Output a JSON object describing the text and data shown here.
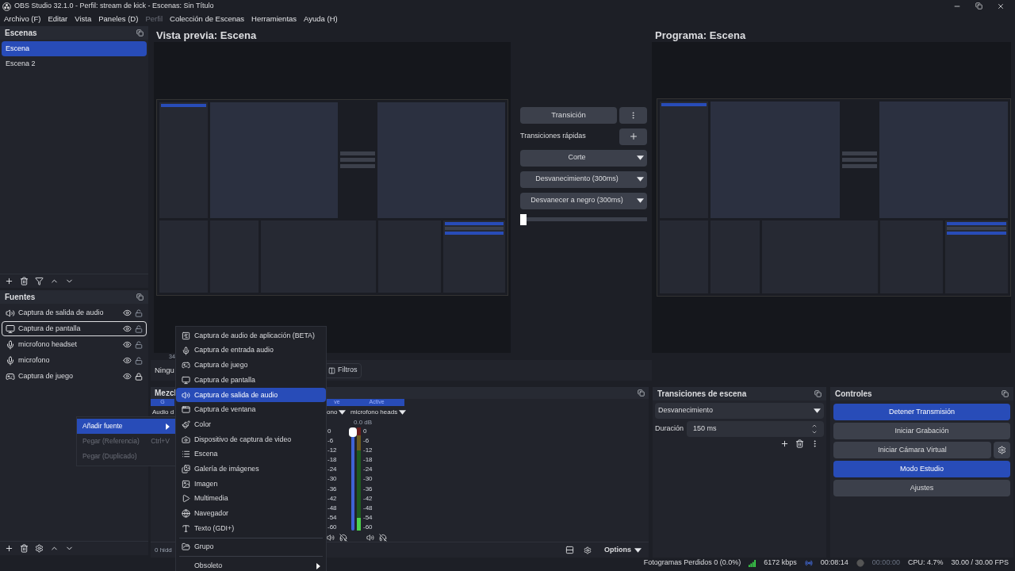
{
  "window": {
    "title": "OBS Studio 32.1.0 - Perfil: stream de kick - Escenas: Sin Título"
  },
  "menubar": [
    {
      "label": "Archivo (F)",
      "disabled": false
    },
    {
      "label": "Editar",
      "disabled": false
    },
    {
      "label": "Vista",
      "disabled": false
    },
    {
      "label": "Paneles (D)",
      "disabled": false
    },
    {
      "label": "Perfil",
      "disabled": true
    },
    {
      "label": "Colección de Escenas",
      "disabled": false
    },
    {
      "label": "Herramientas",
      "disabled": false
    },
    {
      "label": "Ayuda (H)",
      "disabled": false
    }
  ],
  "scenes": {
    "title": "Escenas",
    "items": [
      {
        "name": "Escena",
        "selected": true
      },
      {
        "name": "Escena 2",
        "selected": false
      }
    ]
  },
  "sources": {
    "title": "Fuentes",
    "items": [
      {
        "kind": "audio_output",
        "name": "Captura de salida de audio",
        "selected": false,
        "locked": false
      },
      {
        "kind": "display",
        "name": "Captura de pantalla",
        "selected": true,
        "locked": false
      },
      {
        "kind": "mic",
        "name": "microfono headset",
        "selected": false,
        "locked": false
      },
      {
        "kind": "mic",
        "name": "microfono",
        "selected": false,
        "locked": false
      },
      {
        "kind": "game",
        "name": "Captura de juego",
        "selected": false,
        "locked": true
      }
    ]
  },
  "preview": {
    "title": "Vista previa: Escena",
    "counter": "34"
  },
  "program": {
    "title": "Programa: Escena"
  },
  "studio_transitions": {
    "transition_button": "Transición",
    "quick_label": "Transiciones rápidas",
    "quick": [
      "Corte",
      "Desvanecimiento (300ms)",
      "Desvanecer a negro (300ms)"
    ],
    "slider": {
      "level": 0
    }
  },
  "source_toolbar": {
    "label": "Ningu",
    "filters": "Filtros"
  },
  "mixer": {
    "title": "Mezcl",
    "hidden": "0 hidd",
    "options": "Options",
    "channels": [
      {
        "header": "G",
        "name": "Audio d"
      },
      {
        "header": "ve",
        "name": "ono",
        "ticks": [
          "0",
          "-6",
          "-12",
          "-18",
          "-24",
          "-30",
          "-36",
          "-42",
          "-48",
          "-54",
          "-60"
        ]
      },
      {
        "header": "Active",
        "name": "microfono heads",
        "db": "0.0 dB",
        "ticks": [
          "0",
          "-6",
          "-12",
          "-18",
          "-24",
          "-30",
          "-36",
          "-42",
          "-48",
          "-54",
          "-60"
        ],
        "fader": {
          "level": 1
        },
        "meter": {
          "level": 0.12
        }
      }
    ]
  },
  "scene_transitions": {
    "title": "Transiciones de escena",
    "transition": "Desvanecimiento",
    "duration_label": "Duración",
    "duration": "150 ms"
  },
  "controls": {
    "title": "Controles",
    "buttons": [
      {
        "label": "Detener Transmisión",
        "active": true
      },
      {
        "label": "Iniciar Grabación",
        "active": false
      },
      {
        "label": "Iniciar Cámara Virtual",
        "active": false,
        "settings": true
      },
      {
        "label": "Modo Estudio",
        "active": true
      },
      {
        "label": "Ajustes",
        "active": false
      }
    ]
  },
  "context_menu": [
    {
      "label": "Añadir fuente",
      "selected": true,
      "disabled": false,
      "submenu": true
    },
    {
      "label": "Pegar (Referencia)",
      "shortcut": "Ctrl+V",
      "selected": false,
      "disabled": true
    },
    {
      "label": "Pegar (Duplicado)",
      "selected": false,
      "disabled": true
    }
  ],
  "add_source_menu": [
    {
      "kind": "app_audio",
      "label": "Captura de audio de aplicación (BETA)",
      "selected": false
    },
    {
      "kind": "mic",
      "label": "Captura de entrada audio",
      "selected": false
    },
    {
      "kind": "game",
      "label": "Captura de juego",
      "selected": false
    },
    {
      "kind": "display",
      "label": "Captura de pantalla",
      "selected": false
    },
    {
      "kind": "audio_output",
      "label": "Captura de salida de audio",
      "selected": true
    },
    {
      "kind": "window",
      "label": "Captura de ventana",
      "selected": false
    },
    {
      "kind": "color",
      "label": "Color",
      "selected": false
    },
    {
      "kind": "camera",
      "label": "Dispositivo de captura de video",
      "selected": false
    },
    {
      "kind": "scene",
      "label": "Escena",
      "selected": false
    },
    {
      "kind": "slideshow",
      "label": "Galería de imágenes",
      "selected": false
    },
    {
      "kind": "image",
      "label": "Imagen",
      "selected": false
    },
    {
      "kind": "media",
      "label": "Multimedia",
      "selected": false
    },
    {
      "kind": "browser",
      "label": "Navegador",
      "selected": false
    },
    {
      "kind": "text",
      "label": "Texto (GDI+)",
      "selected": false
    },
    {
      "kind": "separator"
    },
    {
      "kind": "group",
      "label": "Grupo",
      "selected": false
    },
    {
      "kind": "separator"
    },
    {
      "kind": "submenu",
      "label": "Obsoleto",
      "selected": false
    }
  ],
  "status_bar": {
    "dropped": "Fotogramas Perdidos 0 (0.0%)",
    "bitrate": "6172 kbps",
    "stream_time": "00:08:14",
    "record_time": "00:00:00",
    "cpu": "CPU: 4.7%",
    "fps": "30.00 / 30.00 FPS"
  }
}
